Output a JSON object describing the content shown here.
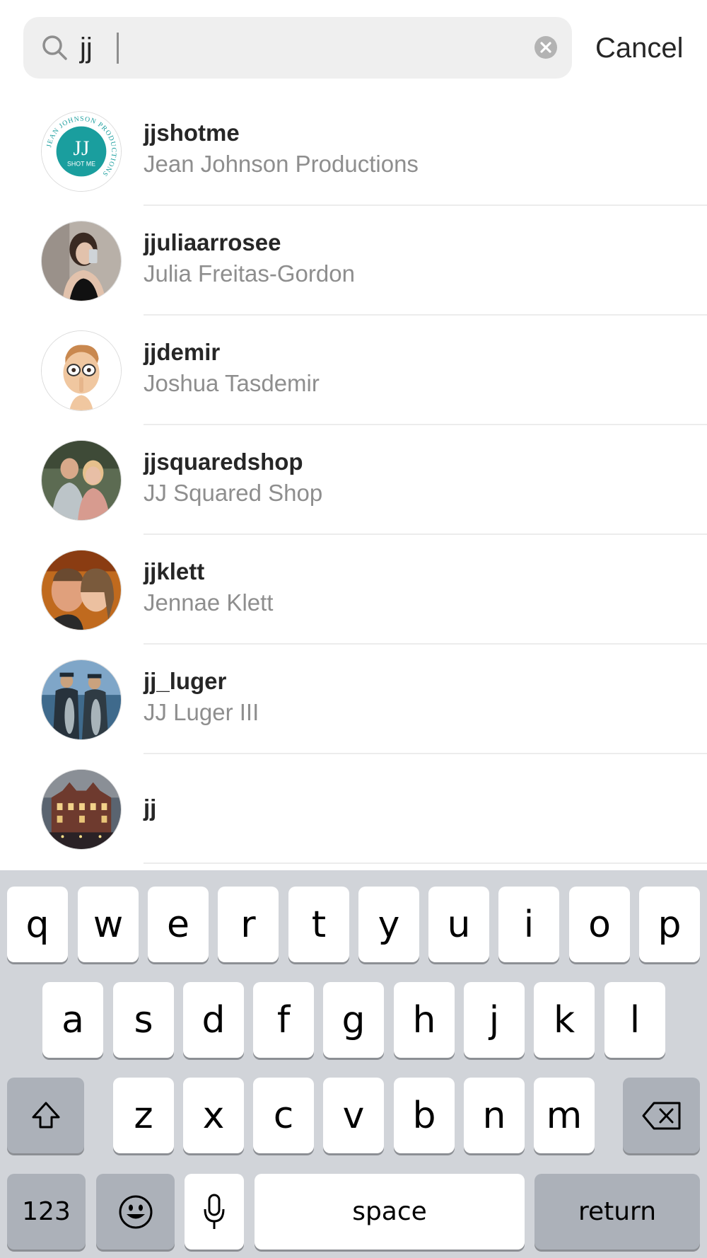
{
  "search": {
    "query": "jj",
    "cancel_label": "Cancel"
  },
  "results": [
    {
      "username": "jjshotme",
      "fullname": "Jean Johnson Productions",
      "avatar": "logo-jj-shot-me"
    },
    {
      "username": "jjuliaarrosee",
      "fullname": "Julia Freitas-Gordon",
      "avatar": "photo-person-selfie"
    },
    {
      "username": "jjdemir",
      "fullname": "Joshua Tasdemir",
      "avatar": "memoji-glasses"
    },
    {
      "username": "jjsquaredshop",
      "fullname": "JJ Squared Shop",
      "avatar": "photo-couple"
    },
    {
      "username": "jjklett",
      "fullname": "Jennae Klett",
      "avatar": "photo-couple-selfie"
    },
    {
      "username": "jj_luger",
      "fullname": "JJ Luger III",
      "avatar": "photo-fishing"
    },
    {
      "username": "jj",
      "fullname": "",
      "avatar": "photo-building"
    }
  ],
  "avatar_logo": {
    "initials": "JJ",
    "tagline": "SHOT ME",
    "ring_text": "JEAN JOHNSON PRODUCTIONS"
  },
  "keyboard": {
    "row1": [
      "q",
      "w",
      "e",
      "r",
      "t",
      "y",
      "u",
      "i",
      "o",
      "p"
    ],
    "row2": [
      "a",
      "s",
      "d",
      "f",
      "g",
      "h",
      "j",
      "k",
      "l"
    ],
    "row3": [
      "z",
      "x",
      "c",
      "v",
      "b",
      "n",
      "m"
    ],
    "numbers_label": "123",
    "space_label": "space",
    "return_label": "return",
    "icons": [
      "shift-icon",
      "delete-icon",
      "emoji-icon",
      "microphone-icon"
    ]
  },
  "colors": {
    "search_bg": "#efefef",
    "secondary_text": "#8e8e8e",
    "keyboard_bg": "#d1d4d9",
    "dark_key": "#acb1b9",
    "logo_teal": "#1a9e9e"
  }
}
